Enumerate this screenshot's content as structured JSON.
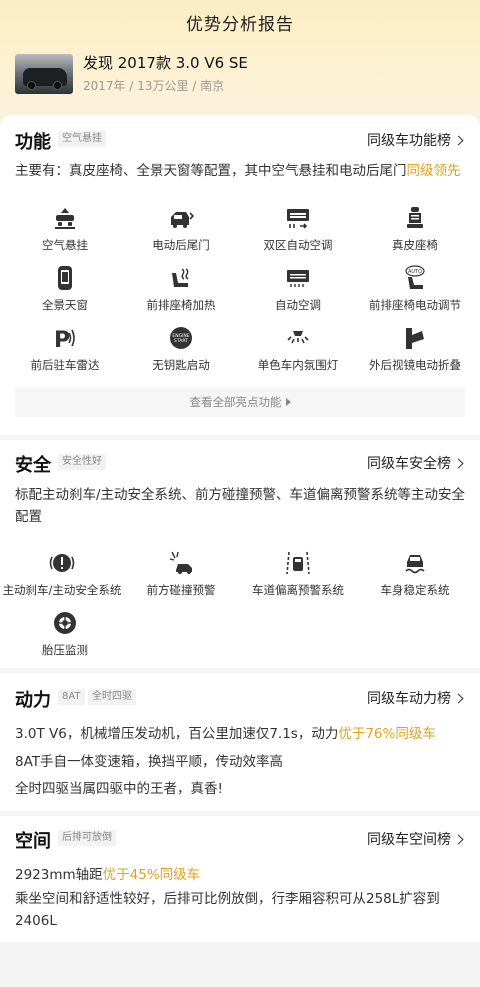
{
  "header": {
    "title": "优势分析报告"
  },
  "car": {
    "name": "发现 2017款 3.0 V6 SE",
    "meta": "2017年 / 13万公里 / 南京"
  },
  "function": {
    "title": "功能",
    "tag": "空气悬挂",
    "rank_link": "同级车功能榜",
    "desc_prefix": "主要有：真皮座椅、全景天窗等配置，其中空气悬挂和电动后尾门",
    "desc_highlight": "同级领先",
    "features": [
      {
        "label": "空气悬挂",
        "icon": "air-suspension-icon"
      },
      {
        "label": "电动后尾门",
        "icon": "power-tailgate-icon"
      },
      {
        "label": "双区自动空调",
        "icon": "dual-zone-ac-icon"
      },
      {
        "label": "真皮座椅",
        "icon": "leather-seat-icon"
      },
      {
        "label": "全景天窗",
        "icon": "panoramic-sunroof-icon"
      },
      {
        "label": "前排座椅加热",
        "icon": "seat-heating-icon"
      },
      {
        "label": "自动空调",
        "icon": "auto-ac-icon"
      },
      {
        "label": "前排座椅电动调节",
        "icon": "power-seat-icon"
      },
      {
        "label": "前后驻车雷达",
        "icon": "parking-radar-icon"
      },
      {
        "label": "无钥匙启动",
        "icon": "keyless-start-icon"
      },
      {
        "label": "单色车内氛围灯",
        "icon": "ambient-light-icon"
      },
      {
        "label": "外后视镜电动折叠",
        "icon": "mirror-fold-icon"
      }
    ],
    "more_label": "查看全部亮点功能"
  },
  "safety": {
    "title": "安全",
    "tag": "安全性好",
    "rank_link": "同级车安全榜",
    "desc": "标配主动刹车/主动安全系统、前方碰撞预警、车道偏离预警系统等主动安全配置",
    "features": [
      {
        "label": "主动刹车/主动安全系统",
        "icon": "active-brake-icon"
      },
      {
        "label": "前方碰撞预警",
        "icon": "collision-warning-icon"
      },
      {
        "label": "车道偏离预警系统",
        "icon": "lane-departure-icon"
      },
      {
        "label": "车身稳定系统",
        "icon": "stability-control-icon"
      },
      {
        "label": "胎压监测",
        "icon": "tire-pressure-icon"
      }
    ]
  },
  "power": {
    "title": "动力",
    "tag1": "8AT",
    "tag2": "全时四驱",
    "rank_link": "同级车动力榜",
    "line1_prefix": "3.0T V6，机械增压发动机，百公里加速仅7.1s，动力",
    "line1_highlight": "优于76%同级车",
    "line2": "8AT手自一体变速箱，换挡平顺，传动效率高",
    "line3": "全时四驱当属四驱中的王者，真香!"
  },
  "space": {
    "title": "空间",
    "tag": "后排可放倒",
    "rank_link": "同级车空间榜",
    "line1_prefix": "2923mm轴距",
    "line1_highlight": "优于45%同级车",
    "line2": "乘坐空间和舒适性较好，后排可比例放倒，行李厢容积可从258L扩容到2406L"
  },
  "colors": {
    "accent": "#e3a21b",
    "header_gradient_top": "#fbeec4"
  }
}
